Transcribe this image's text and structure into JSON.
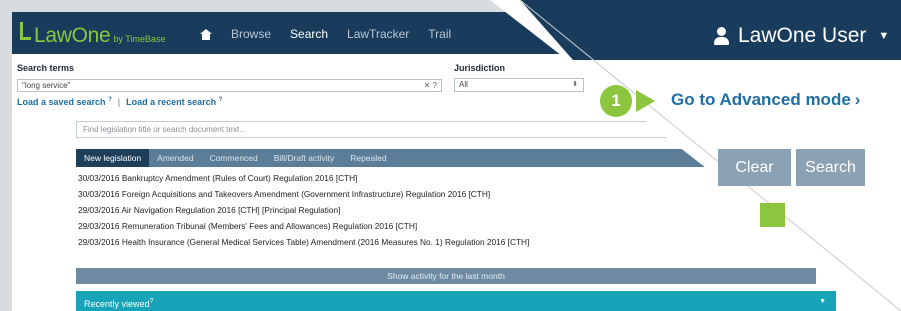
{
  "header": {
    "logo_name": "LawOne",
    "logo_by": "by TimeBase",
    "nav": [
      "Browse",
      "Search",
      "LawTracker",
      "Trail"
    ],
    "active_nav": "Search",
    "user_name": "LawOne User"
  },
  "search": {
    "label": "Search terms",
    "value": "\"long service\"",
    "clear_glyph": "✕ ?",
    "jurisdiction_label": "Jurisdiction",
    "jurisdiction_value": "All",
    "load_saved": "Load a saved search",
    "load_recent": "Load a recent search",
    "separator": "|",
    "help_mark": "?",
    "find_placeholder": "Find legislation title or search document text...",
    "advanced_link": "Go to Advanced mode",
    "clear_button": "Clear",
    "search_button": "Search"
  },
  "callout": {
    "step": "1"
  },
  "activity": {
    "tabs": [
      "New legislation",
      "Amended",
      "Commenced",
      "Bill/Draft activity",
      "Repealed"
    ],
    "active_tab": "New legislation",
    "rows": [
      "30/03/2016 Bankruptcy Amendment (Rules of Court) Regulation 2016 [CTH]",
      "30/03/2016 Foreign Acquisitions and Takeovers Amendment (Government Infrastructure) Regulation 2016 [CTH]",
      "29/03/2016 Air Navigation Regulation 2016 [CTH] [Principal Regulation]",
      "29/03/2016 Remuneration Tribunal (Members' Fees and Allowances) Regulation 2016 [CTH]",
      "29/03/2016 Health Insurance (General Medical Services Table) Amendment (2016 Measures No. 1) Regulation 2016 [CTH]"
    ],
    "show_more": "Show activity for the last month"
  },
  "recently_viewed": {
    "label": "Recently viewed",
    "help_mark": "?"
  },
  "colors": {
    "navbar": "#1a3c5c",
    "brand_green": "#8cc63f",
    "link_blue": "#1f6ea5",
    "teal_bar": "#17a3b8",
    "button_grey": "#8ba1b4"
  },
  "icons": [
    "home-icon",
    "user-icon",
    "chevron-down-icon",
    "chevron-right-icon",
    "close-icon"
  ]
}
